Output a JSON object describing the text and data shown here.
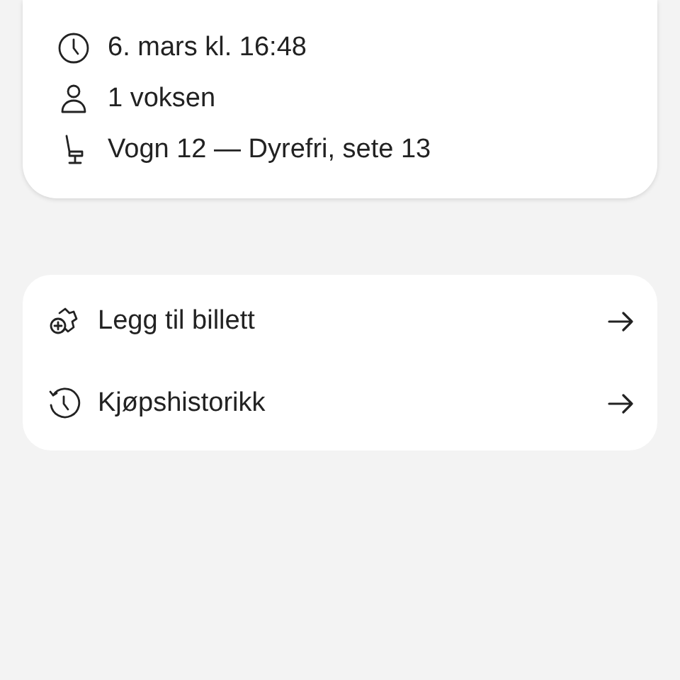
{
  "trip_details": [
    {
      "kind": "time",
      "text": "6. mars kl. 16:48"
    },
    {
      "kind": "passengers",
      "text": "1 voksen"
    },
    {
      "kind": "seat",
      "text": "Vogn 12 — Dyrefri, sete 13"
    }
  ],
  "actions": [
    {
      "kind": "add",
      "label": "Legg til billett"
    },
    {
      "kind": "history",
      "label": "Kjøpshistorikk"
    }
  ]
}
